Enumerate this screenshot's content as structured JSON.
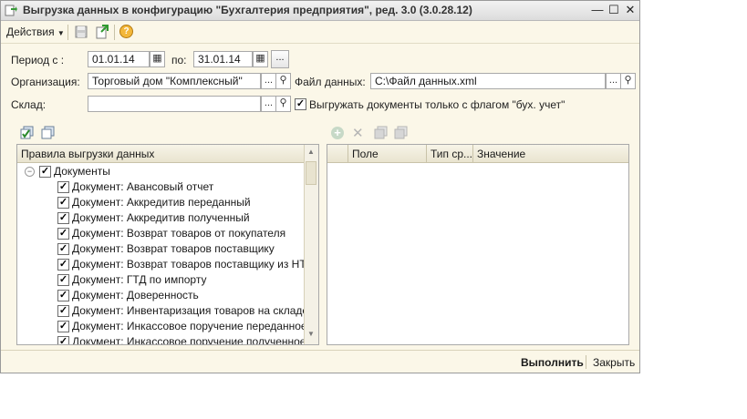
{
  "window": {
    "title": "Выгрузка данных в конфигурацию \"Бухгалтерия предприятия\", ред. 3.0 (3.0.28.12)"
  },
  "title_buttons": {
    "minimize": "—",
    "maximize": "☐",
    "close": "✕"
  },
  "toolbar": {
    "actions_label": "Действия",
    "help_glyph": "?"
  },
  "form": {
    "period_from_label": "Период с :",
    "period_from_value": "01.01.14",
    "period_to_label": "по:",
    "period_to_value": "31.01.14",
    "organization_label": "Организация:",
    "organization_value": "Торговый дом \"Комплексный\"",
    "data_file_label": "Файл данных:",
    "data_file_value": "C:\\Файл данных.xml",
    "warehouse_label": "Склад:",
    "warehouse_value": "",
    "export_flag_label": "Выгружать документы только с флагом \"бух. учет\"",
    "export_flag_checked": true,
    "dots_label": "..."
  },
  "rules_panel": {
    "header": "Правила выгрузки данных",
    "root": {
      "label": "Документы",
      "checked": true
    },
    "items": [
      {
        "label": "Документ: Авансовый отчет",
        "checked": true
      },
      {
        "label": "Документ: Аккредитив переданный",
        "checked": true
      },
      {
        "label": "Документ: Аккредитив полученный",
        "checked": true
      },
      {
        "label": "Документ: Возврат товаров от покупателя",
        "checked": true
      },
      {
        "label": "Документ: Возврат товаров поставщику",
        "checked": true
      },
      {
        "label": "Документ: Возврат товаров поставщику из НТТ",
        "checked": true
      },
      {
        "label": "Документ: ГТД по импорту",
        "checked": true
      },
      {
        "label": "Документ: Доверенность",
        "checked": true
      },
      {
        "label": "Документ: Инвентаризация товаров на складе",
        "checked": true
      },
      {
        "label": "Документ: Инкассовое поручение переданное",
        "checked": true
      },
      {
        "label": "Документ: Инкассовое поручение полученное",
        "checked": true
      }
    ]
  },
  "params_panel": {
    "columns": [
      "Поле",
      "Тип ср...",
      "Значение"
    ]
  },
  "bottom": {
    "execute_label": "Выполнить",
    "close_label": "Закрыть"
  },
  "colors": {
    "window_bg": "#fbf7e8",
    "border": "#a9a9a9",
    "header_bg": "#ece7d3"
  }
}
